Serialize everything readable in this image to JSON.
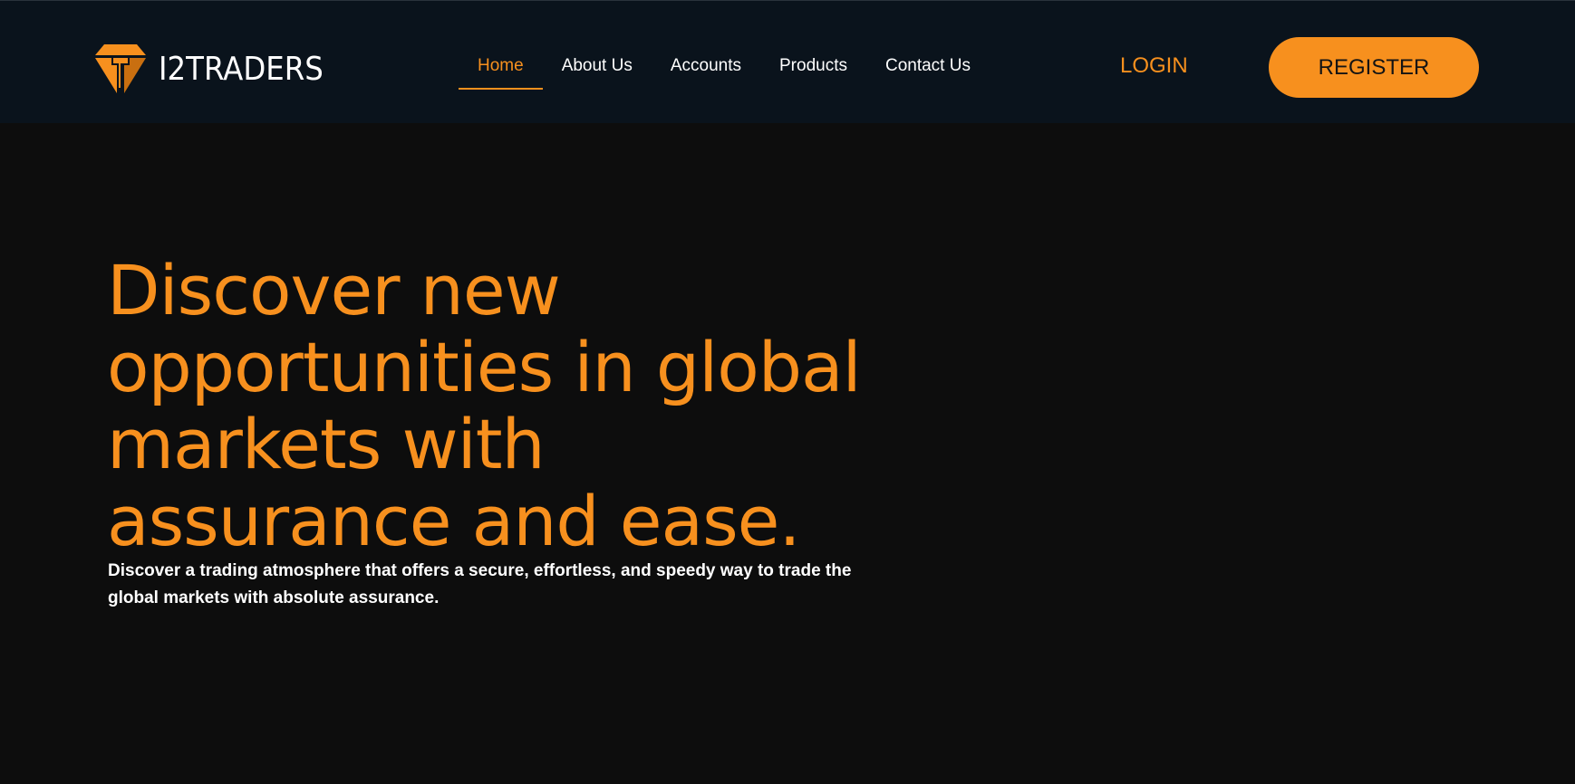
{
  "brand": {
    "name": "I2TRADERS",
    "accent_color": "#f7901e",
    "header_bg": "#0a131c",
    "page_bg": "#0d0d0d"
  },
  "nav": {
    "items": [
      {
        "label": "Home",
        "active": true
      },
      {
        "label": "About Us",
        "active": false
      },
      {
        "label": "Accounts",
        "active": false
      },
      {
        "label": "Products",
        "active": false
      },
      {
        "label": "Contact Us",
        "active": false
      }
    ]
  },
  "auth": {
    "login_label": "LOGIN",
    "register_label": "REGISTER"
  },
  "hero": {
    "title": "Discover new opportunities in global markets with assurance and ease.",
    "subtitle": "Discover a trading atmosphere that offers a secure, effortless, and speedy way to trade the global markets with absolute assurance."
  }
}
